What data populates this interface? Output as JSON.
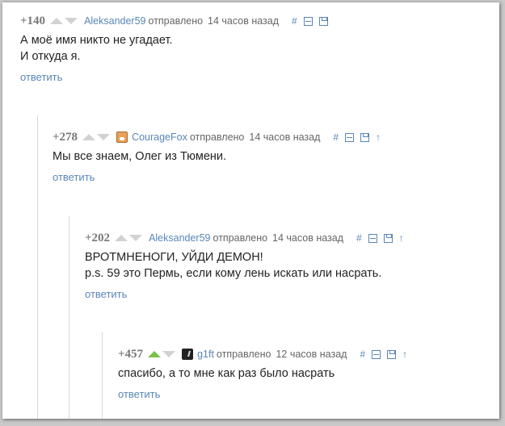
{
  "comments": [
    {
      "score": "+140",
      "author": "Aleksander59",
      "sent_label": "отправлено",
      "time": "14 часов назад",
      "lines": [
        "А моё имя никто не угадает.",
        "И откуда я."
      ],
      "reply": "ответить"
    },
    {
      "score": "+278",
      "author": "CourageFox",
      "sent_label": "отправлено",
      "time": "14 часов назад",
      "lines": [
        "Мы все знаем, Олег из Тюмени."
      ],
      "reply": "ответить"
    },
    {
      "score": "+202",
      "author": "Aleksander59",
      "sent_label": "отправлено",
      "time": "14 часов назад",
      "lines": [
        "ВРОТМНЕНОГИ, УЙДИ ДЕМОН!",
        "p.s. 59 это Пермь, если кому лень искать или насрать."
      ],
      "reply": "ответить"
    },
    {
      "score": "+457",
      "author": "g1ft",
      "sent_label": "отправлено",
      "time": "12 часов назад",
      "lines": [
        "спасибо, а то мне как раз было насрать"
      ],
      "reply": "ответить"
    }
  ],
  "tool_icons": {
    "hash": "#",
    "parent": "↑"
  },
  "colors": {
    "link": "#5a86b8",
    "upvoted": "#7cc04a",
    "arrow_inactive": "#d2d2d2"
  }
}
